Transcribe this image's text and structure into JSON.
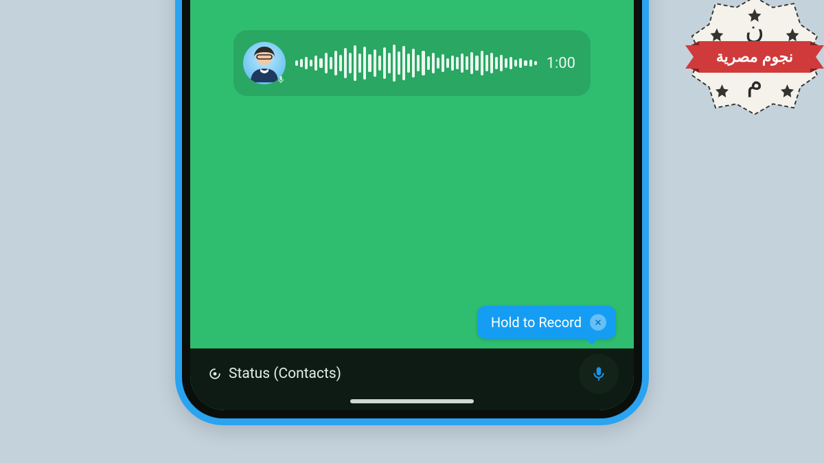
{
  "voice_message": {
    "duration": "1:00",
    "waveform_heights": [
      8,
      12,
      18,
      10,
      22,
      14,
      30,
      18,
      36,
      24,
      44,
      30,
      52,
      28,
      48,
      26,
      40,
      22,
      46,
      30,
      54,
      34,
      50,
      28,
      42,
      24,
      36,
      20,
      30,
      16,
      26,
      14,
      22,
      18,
      28,
      20,
      32,
      22,
      36,
      24,
      30,
      18,
      24,
      14,
      18,
      10,
      14,
      8,
      10,
      6
    ]
  },
  "tooltip": {
    "label": "Hold to Record"
  },
  "bottom_bar": {
    "status_label": "Status (Contacts)"
  },
  "logo": {
    "ribbon_text": "نجوم مصرية"
  },
  "colors": {
    "bg": "#c4d2dc",
    "screen_green": "#2fbe6f",
    "bubble_green": "#29a763",
    "tooltip_blue": "#149DF3",
    "mic_blue": "#1b94e4",
    "ribbon_red": "#d13a3a"
  }
}
